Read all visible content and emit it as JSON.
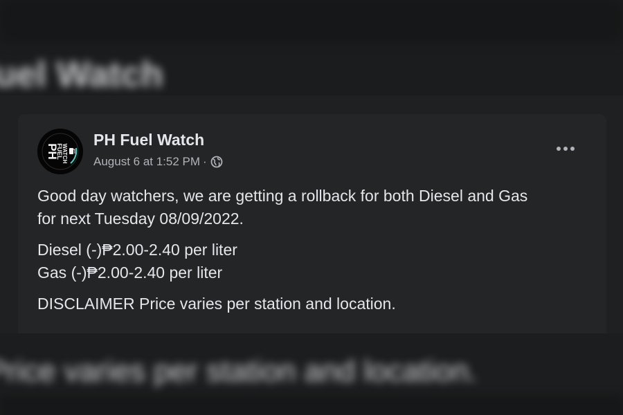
{
  "background": {
    "top_text": "Fuel Watch",
    "bottom_text": "Price varies per station and location."
  },
  "post": {
    "author": "PH Fuel Watch",
    "avatar_text_line1": "PH",
    "avatar_text_line2": "FUEL",
    "avatar_text_line3": "WATCH",
    "timestamp": "August 6 at 1:52 PM",
    "separator": "·",
    "privacy_icon": "globe-icon",
    "more_icon": "more-options-icon",
    "body": {
      "line1": "Good day watchers, we are getting a rollback for both Diesel and Gas",
      "line2": "for next Tuesday 08/09/2022.",
      "diesel": "Diesel (-)₱2.00-2.40 per liter",
      "gas": "Gas (-)₱2.00-2.40 per liter",
      "disclaimer": "DISCLAIMER Price varies per station and location."
    }
  },
  "colors": {
    "page_bg": "#18191a",
    "card_bg": "#242526",
    "primary_text": "#e4e6eb",
    "secondary_text": "#b0b3b8",
    "avatar_bg": "#050505",
    "avatar_accent": "#4fd1c5"
  }
}
